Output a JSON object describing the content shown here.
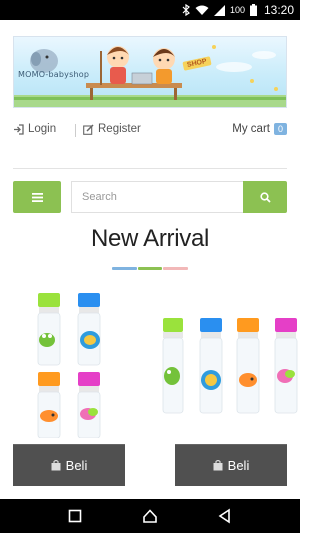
{
  "status_bar": {
    "battery": "100",
    "time": "13:20"
  },
  "banner": {
    "logo_text": "MOMO-babyshop",
    "sign_text": "SHOP"
  },
  "account": {
    "login_label": "Login",
    "register_label": "Register",
    "cart_label": "My cart",
    "cart_count": "0"
  },
  "search": {
    "placeholder": "Search"
  },
  "section": {
    "title": "New Arrival",
    "underline_colors": [
      "#7fb3e0",
      "#8cc152",
      "#f2b8b8"
    ]
  },
  "products": [
    {
      "buy_label": "Beli"
    },
    {
      "buy_label": "Beli"
    }
  ],
  "colors": {
    "accent_green": "#8cc152",
    "button_dark": "#505050",
    "cart_badge": "#7fb3e0"
  },
  "icons": {
    "status": [
      "bluetooth-icon",
      "wifi-icon",
      "signal-icon",
      "battery-icon"
    ],
    "account": [
      "login-icon",
      "edit-icon"
    ],
    "toolbar": [
      "hamburger-icon",
      "search-icon"
    ],
    "product": [
      "shopping-bag-icon"
    ],
    "nav": [
      "back-icon",
      "home-icon",
      "recents-icon"
    ]
  }
}
